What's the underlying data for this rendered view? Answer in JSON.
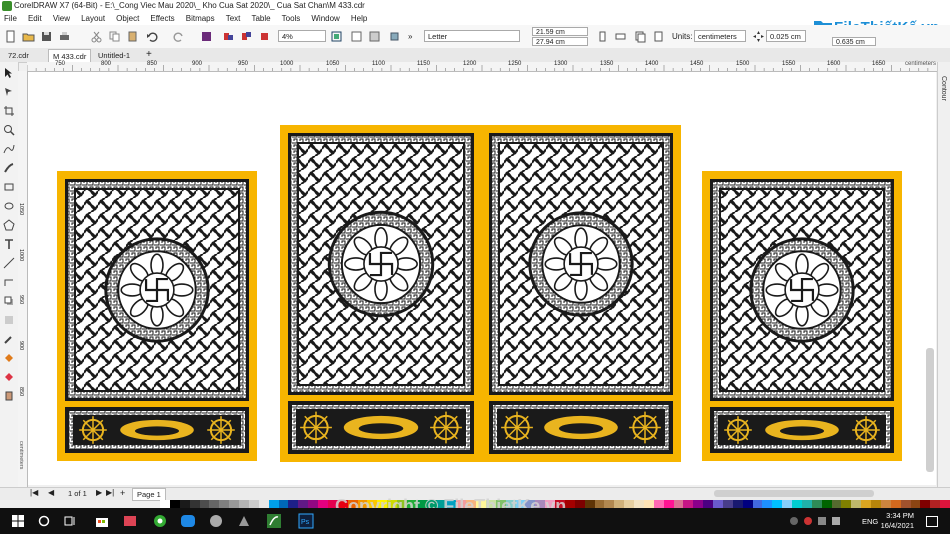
{
  "titlebar": {
    "title": "CorelDRAW X7 (64-Bit) - E:\\_Cong Viec Mau 2020\\_ Kho Cua Sat 2020\\_ Cua Sat Chan\\M 433.cdr"
  },
  "menu": [
    "File",
    "Edit",
    "View",
    "Layout",
    "Object",
    "Effects",
    "Bitmaps",
    "Text",
    "Table",
    "Tools",
    "Window",
    "Help"
  ],
  "toolbar": {
    "zoom": "4%",
    "paper": "Letter",
    "width": "21.59 cm",
    "height": "27.94 cm",
    "units_label": "Units:",
    "units": "centimeters",
    "nudge": "0.025 cm",
    "dup": "0.635 cm"
  },
  "brand": {
    "name": "FileThiếtKế.vn"
  },
  "tabs": [
    "72.cdr",
    "M 433.cdr",
    "Untitled-1"
  ],
  "ruler": {
    "ticks": [
      "750",
      "800",
      "850",
      "900",
      "950",
      "1000",
      "1050",
      "1100",
      "1150",
      "1200",
      "1250",
      "1300",
      "1350",
      "1400",
      "1450",
      "1500",
      "1550",
      "1600",
      "1650"
    ],
    "unit": "centimeters",
    "vticks": [
      "1050",
      "1000",
      "950",
      "900",
      "850"
    ],
    "vunit": "centimeters"
  },
  "docker": {
    "label": "Contour"
  },
  "status": {
    "page_of": "1 of 1",
    "page_tab": "Page 1"
  },
  "watermark": {
    "text": "Copyright © FileThietKe.vn"
  },
  "taskbar": {
    "lang": "ENG",
    "time": "3:34 PM",
    "date": "16/4/2021"
  },
  "colors": {
    "frame": "#f7b500",
    "pattern": "#1a1a1a",
    "gold": "#e9b41f",
    "accent": "#1d8fd6"
  },
  "palette": [
    "#ffffff",
    "#000000",
    "#1a1a1a",
    "#333333",
    "#4d4d4d",
    "#666666",
    "#808080",
    "#999999",
    "#b3b3b3",
    "#cccccc",
    "#e6e6e6",
    "#00a0e9",
    "#0068b7",
    "#1d2088",
    "#601986",
    "#920783",
    "#e4007f",
    "#e5004f",
    "#e60012",
    "#eb6100",
    "#f39800",
    "#fcc800",
    "#fff100",
    "#cfdb00",
    "#8fc31f",
    "#22ac38",
    "#009944",
    "#009b6b",
    "#009e96",
    "#00a0c1",
    "#f29c9f",
    "#f6b37f",
    "#fff799",
    "#c9e1a1",
    "#80c269",
    "#84ccc9",
    "#7ecef4",
    "#8493ca",
    "#aa89bd",
    "#f19ec2",
    "#c30d23",
    "#a40000",
    "#7d0000",
    "#5f3406",
    "#996c33",
    "#b28850",
    "#d0b17a",
    "#e6cfa0",
    "#f3e3c3",
    "#ffe4b5",
    "#ff69b4",
    "#ff1493",
    "#db7093",
    "#c71585",
    "#8b008b",
    "#4b0082",
    "#6a5acd",
    "#483d8b",
    "#191970",
    "#000080",
    "#4169e1",
    "#1e90ff",
    "#00bfff",
    "#87cefa",
    "#00ced1",
    "#20b2aa",
    "#2e8b57",
    "#006400",
    "#556b2f",
    "#808000",
    "#bdb76b",
    "#daa520",
    "#b8860b",
    "#cd853f",
    "#d2691e",
    "#a0522d",
    "#8b4513",
    "#800000",
    "#b22222",
    "#dc143c"
  ]
}
